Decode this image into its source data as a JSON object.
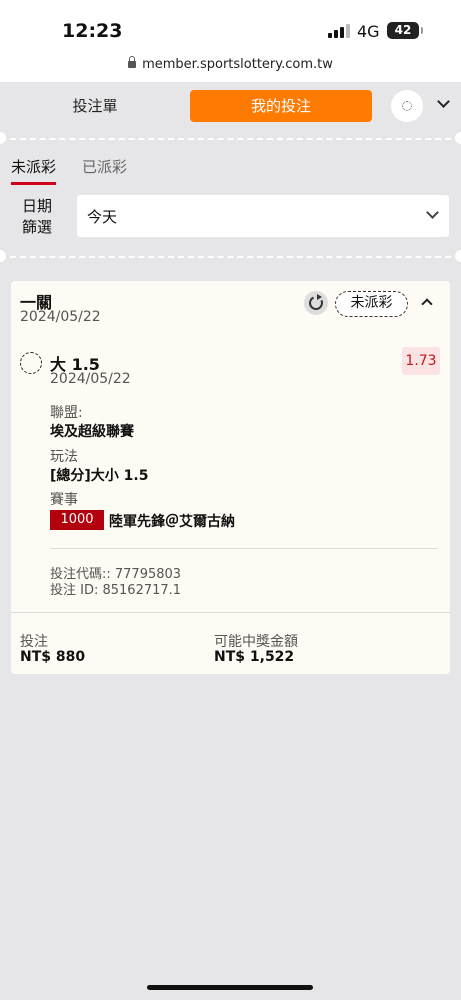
{
  "status_bar": {
    "time": "12:23",
    "network": "4G",
    "battery": "42"
  },
  "browser": {
    "url": "member.sportslottery.com.tw"
  },
  "header": {
    "tab_slip": "投注單",
    "tab_my_bets": "我的投注"
  },
  "filters": {
    "tab_unsettled": "未派彩",
    "tab_settled": "已派彩",
    "date_label": "日期篩選",
    "date_value": "今天"
  },
  "bet_card": {
    "type": "一關",
    "date": "2024/05/22",
    "status": "未派彩",
    "selection": {
      "title": "大 1.5",
      "date": "2024/05/22",
      "odds": "1.73",
      "league_label": "聯盟:",
      "league_value": "埃及超級聯賽",
      "market_label": "玩法",
      "market_value": "[總分]大小 1.5",
      "event_label": "賽事",
      "event_code": "1000",
      "event_name": "陸軍先鋒＠艾爾古納"
    },
    "bet_code": "投注代碼:: 77795803",
    "bet_id": "投注 ID: 85162717.1",
    "stake_label": "投注",
    "stake_value": "NT$ 880",
    "payout_label": "可能中獎金額",
    "payout_value": "NT$ 1,522"
  },
  "icons": [
    "lock-icon",
    "gear-icon",
    "chevron-down-icon",
    "refresh-icon",
    "chevron-up-icon"
  ],
  "colors": {
    "accent": "#ff7a00",
    "active_tab_underline": "#d0021b",
    "event_code_bg": "#b3000e",
    "odds": "#c0181b"
  }
}
